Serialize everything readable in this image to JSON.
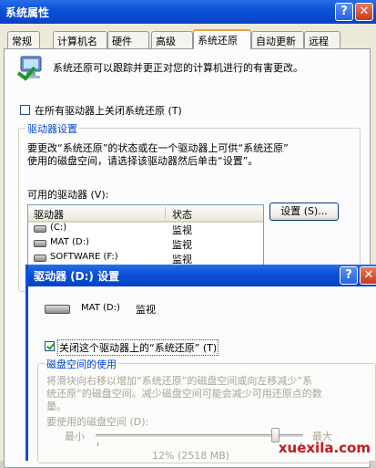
{
  "window": {
    "title": "系统属性",
    "help": "?",
    "close": "✕"
  },
  "tabs": [
    {
      "label": "常规"
    },
    {
      "label": "计算机名"
    },
    {
      "label": "硬件"
    },
    {
      "label": "高级"
    },
    {
      "label": "系统还原"
    },
    {
      "label": "自动更新"
    },
    {
      "label": "远程"
    }
  ],
  "main": {
    "description": "系统还原可以跟踪并更正对您的计算机进行的有害更改。",
    "disable_all_label": "在所有驱动器上关闭系统还原 (T)",
    "disable_all_checked": false,
    "drive_settings_title": "驱动器设置",
    "drive_settings_text_1": "要更改“系统还原”的状态或在一个驱动器上可供“系统还原”",
    "drive_settings_text_2": "使用的磁盘空间，请选择该驱动器然后单击“设置”。",
    "available_drives_label": "可用的驱动器 (V):",
    "columns": {
      "drive": "驱动器",
      "status": "状态"
    },
    "drives": [
      {
        "name": "(C:)",
        "status": "监视"
      },
      {
        "name": "MAT (D:)",
        "status": "监视"
      },
      {
        "name": "SOFTWARE (F:)",
        "status": "监视"
      }
    ],
    "settings_button": "设置 (S)..."
  },
  "dialog": {
    "title": "驱动器 (D:) 设置",
    "drive_name": "MAT (D:)",
    "drive_status": "监视",
    "disable_label": "关闭这个驱动器上的“系统还原” (T)",
    "disable_checked": true,
    "disk_usage_title": "磁盘空间的使用",
    "disk_usage_text_1": "将滑块向右移以增加“系统还原”的磁盘空间或向左移减少“系",
    "disk_usage_text_2": "统还原”的磁盘空间。减少磁盘空间可能会减少可用还原点的数",
    "disk_usage_text_3": "量。",
    "disk_space_label": "要使用的磁盘空间 (D):",
    "min_label": "最小",
    "max_label": "最大",
    "slider_value_fraction": 0.88,
    "usage_readout": "12% (2518 MB)"
  },
  "watermark": "xuexila.com",
  "colors": {
    "titlebar": "#0a4fd6",
    "group_title": "#0046d5",
    "watermark": "#c8171c"
  }
}
